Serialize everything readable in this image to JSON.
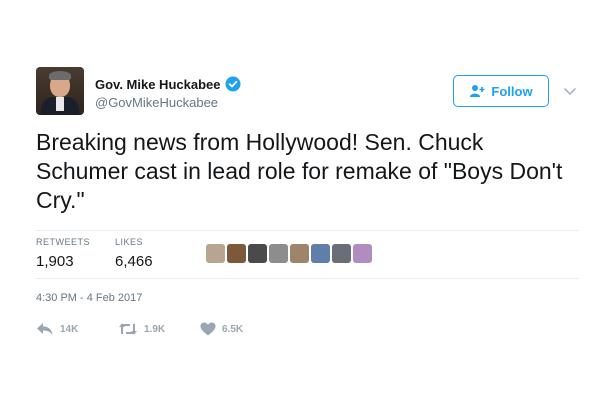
{
  "tweet": {
    "author": {
      "display_name": "Gov. Mike Huckabee",
      "handle": "@GovMikeHuckabee",
      "verified": true
    },
    "follow_label": "Follow",
    "text": "Breaking news from Hollywood!  Sen. Chuck Schumer cast in lead role for remake of \"Boys Don't Cry.\"",
    "stats": {
      "retweets_label": "RETWEETS",
      "retweets_value": "1,903",
      "likes_label": "LIKES",
      "likes_value": "6,466"
    },
    "timestamp": "4:30 PM - 4 Feb 2017",
    "actions": {
      "reply_count": "14K",
      "retweet_count": "1.9K",
      "like_count": "6.5K"
    }
  },
  "colors": {
    "accent": "#1da1f2",
    "text": "#14171a",
    "muted": "#657786",
    "action": "#9aa7b2"
  }
}
